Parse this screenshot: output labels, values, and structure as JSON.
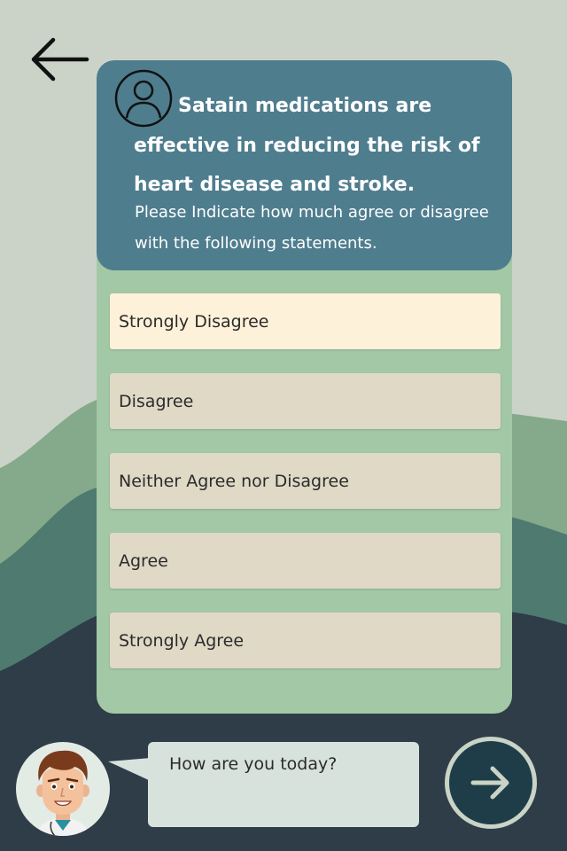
{
  "colors": {
    "background_top": "#cbd3c9",
    "hill_light": "#84a98b",
    "hill_mid": "#4f7a70",
    "hill_dark": "#2e3d48",
    "card": "#a3c8a6",
    "card_header": "#4e7d8e",
    "option": "#dfd9c6",
    "option_selected": "#fef1d9",
    "next_button": "#1e3d48"
  },
  "nav": {
    "back_icon": "arrow-left-icon"
  },
  "survey": {
    "avatar_icon": "user-circle-icon",
    "question": "Satain medications are effective in reducing the risk of heart disease and stroke.",
    "instruction": "Please Indicate how much agree or disagree with the following statements.",
    "options": [
      {
        "label": "Strongly Disagree",
        "highlighted": true
      },
      {
        "label": "Disagree",
        "highlighted": false
      },
      {
        "label": "Neither Agree nor Disagree",
        "highlighted": false
      },
      {
        "label": "Agree",
        "highlighted": false
      },
      {
        "label": "Strongly Agree",
        "highlighted": false
      }
    ]
  },
  "assistant": {
    "avatar_icon": "doctor-avatar-icon",
    "message": "How are you today?"
  },
  "next": {
    "icon": "arrow-right-icon"
  }
}
